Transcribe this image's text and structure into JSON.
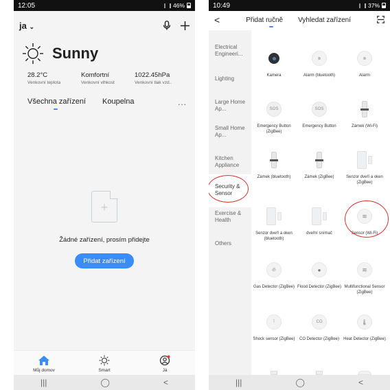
{
  "left": {
    "status": {
      "time": "12:05",
      "battery": "46%"
    },
    "home_name": "ja",
    "weather": {
      "condition": "Sunny",
      "stats": [
        {
          "value": "28.2°C",
          "label": "Venkovní teplota"
        },
        {
          "value": "Komfortní",
          "label": "Venkovní vlhkost"
        },
        {
          "value": "1022.45hPa",
          "label": "Venkovní tlak vzd.."
        }
      ]
    },
    "tabs": [
      "Všechna zařízení",
      "Koupelna"
    ],
    "more": "...",
    "empty_text": "Žádné zařízení, prosím přidejte",
    "add_button": "Přidat zařízení",
    "bottom_tabs": [
      "Můj domov",
      "Smart",
      "Já"
    ],
    "nav": [
      "|||",
      "◯",
      "<"
    ]
  },
  "right": {
    "status": {
      "time": "10:49",
      "battery": "37%"
    },
    "header": {
      "back": "<",
      "tab1": "Přidat ručně",
      "tab2": "Vyhledat zařízení"
    },
    "categories": [
      "Electrical Engineeri...",
      "Lighting",
      "Large Home Ap...",
      "Small Home Ap...",
      "Kitchen Appliance",
      "Security & Sensor",
      "Exercise & Health",
      "Others"
    ],
    "devices": [
      "Kamera",
      "Alarm (bluetooth)",
      "Alarm",
      "Emergency Button (ZigBee)",
      "Emergency Button",
      "Zámek (Wi-Fi)",
      "Zámek (bluetooth)",
      "Zámek (ZigBee)",
      "Senzor dveří a oken (ZigBee)",
      "Senzor dveří a oken (bluetooth)",
      "dveřní snímač",
      "Sensor (Wi-Fi)",
      "Gas Detector (ZigBee)",
      "Flood Detector (ZigBee)",
      "Multifunctional Sensor (ZigBee)",
      "Shock sensor (ZigBee)",
      "CO Detector (ZigBee)",
      "Heat Detector (ZigBee)"
    ],
    "sos_label": "SOS",
    "co_label": "CO",
    "nav": [
      "|||",
      "◯",
      "<"
    ]
  },
  "colors": {
    "accent": "#3a8df8",
    "highlight": "#d93030"
  }
}
